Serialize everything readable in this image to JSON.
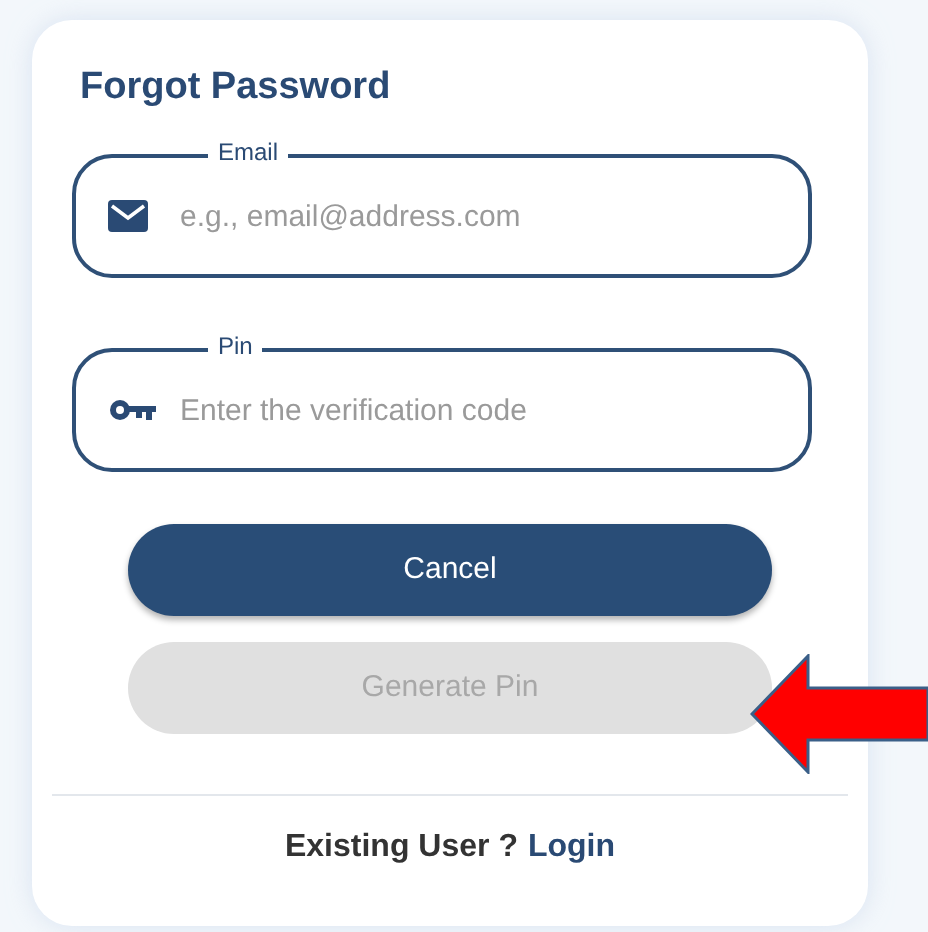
{
  "title": "Forgot Password",
  "fields": [
    {
      "label": "Email",
      "placeholder": "e.g., email@address.com",
      "kind": "email"
    },
    {
      "label": "Pin",
      "placeholder": "Enter the verification code",
      "kind": "pin"
    }
  ],
  "buttons": [
    {
      "label": "Cancel",
      "disabled": false
    },
    {
      "label": "Generate Pin",
      "disabled": true
    }
  ],
  "footer": {
    "text": "Existing User ?",
    "link": "Login"
  }
}
